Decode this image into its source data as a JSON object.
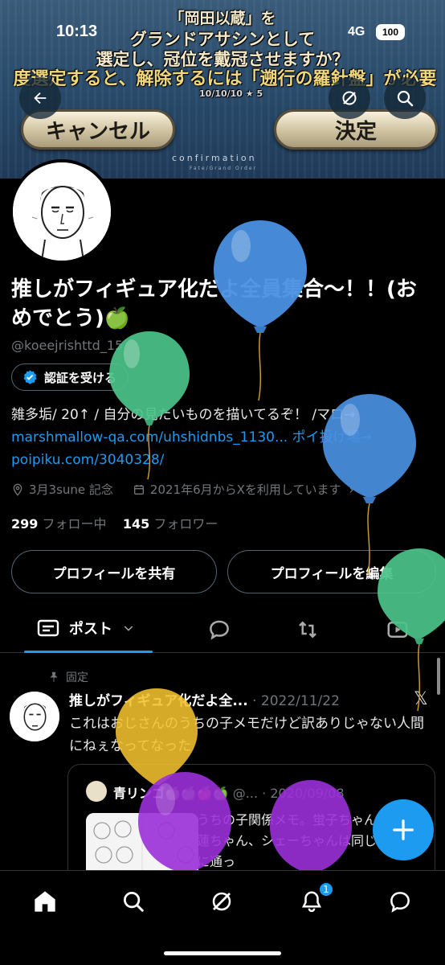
{
  "status_bar": {
    "time": "10:13",
    "network": "4G",
    "battery": "100"
  },
  "banner": {
    "line1": "「岡田以蔵」を",
    "line2": "グランドアサシンとして",
    "line3": "選定し、冠位を戴冠させますか？",
    "line4": "度選定すると、解除するには「遡行の羅針盤」が必要",
    "line5": "10/10/10 ★ 5",
    "cancel_label": "キャンセル",
    "decide_label": "決定",
    "confirmation_label": "confirmation",
    "confirmation_sub": "Fate/Grand Order"
  },
  "profile": {
    "display_name": "推しがフィギュア化だよ全員集合〜！！(おめでとう)🍏",
    "handle": "@koeejrishttd_15",
    "verify_label": "認証を受ける",
    "bio_text": "雑多垢/ 20↑ / 自分の見たいものを描いてるぞ！ /マロ→",
    "bio_link1": "marshmallow-qa.com/uhshidnbs_1130... ポイ投げ場→",
    "bio_link2": "poipiku.com/3040328/",
    "location": "3月3sune 記念",
    "joined": "2021年6月からXを利用しています",
    "following_count": "299",
    "following_label": "フォロー中",
    "followers_count": "145",
    "followers_label": "フォロワー",
    "share_label": "プロフィールを共有",
    "edit_label": "プロフィールを編集"
  },
  "tabs": {
    "posts_label": "ポスト"
  },
  "pinned_post": {
    "pinned_label": "固定",
    "author": "推しがフィギュア化だよ全...",
    "date": "· 2022/11/22",
    "text": "これはおじさんのうちの子メモだけど訳ありじゃない人間にねぇなってなった",
    "quote": {
      "author": "青リンゴ🍏🍏🍎🍏",
      "handle_date": "@... · 2020/09/08",
      "text": "うちの子関係メモ。蛍子ちゃん、香蓮ちゃん、シェーちゃんは同じ学校に通っ"
    }
  },
  "nav": {
    "notifications_badge": "1"
  },
  "colors": {
    "accent": "#1d9bf0",
    "balloon_blue": "#4a90e2",
    "balloon_green": "#4cc38a",
    "balloon_yellow": "#f2c12e",
    "balloon_purple": "#9b30d9"
  }
}
